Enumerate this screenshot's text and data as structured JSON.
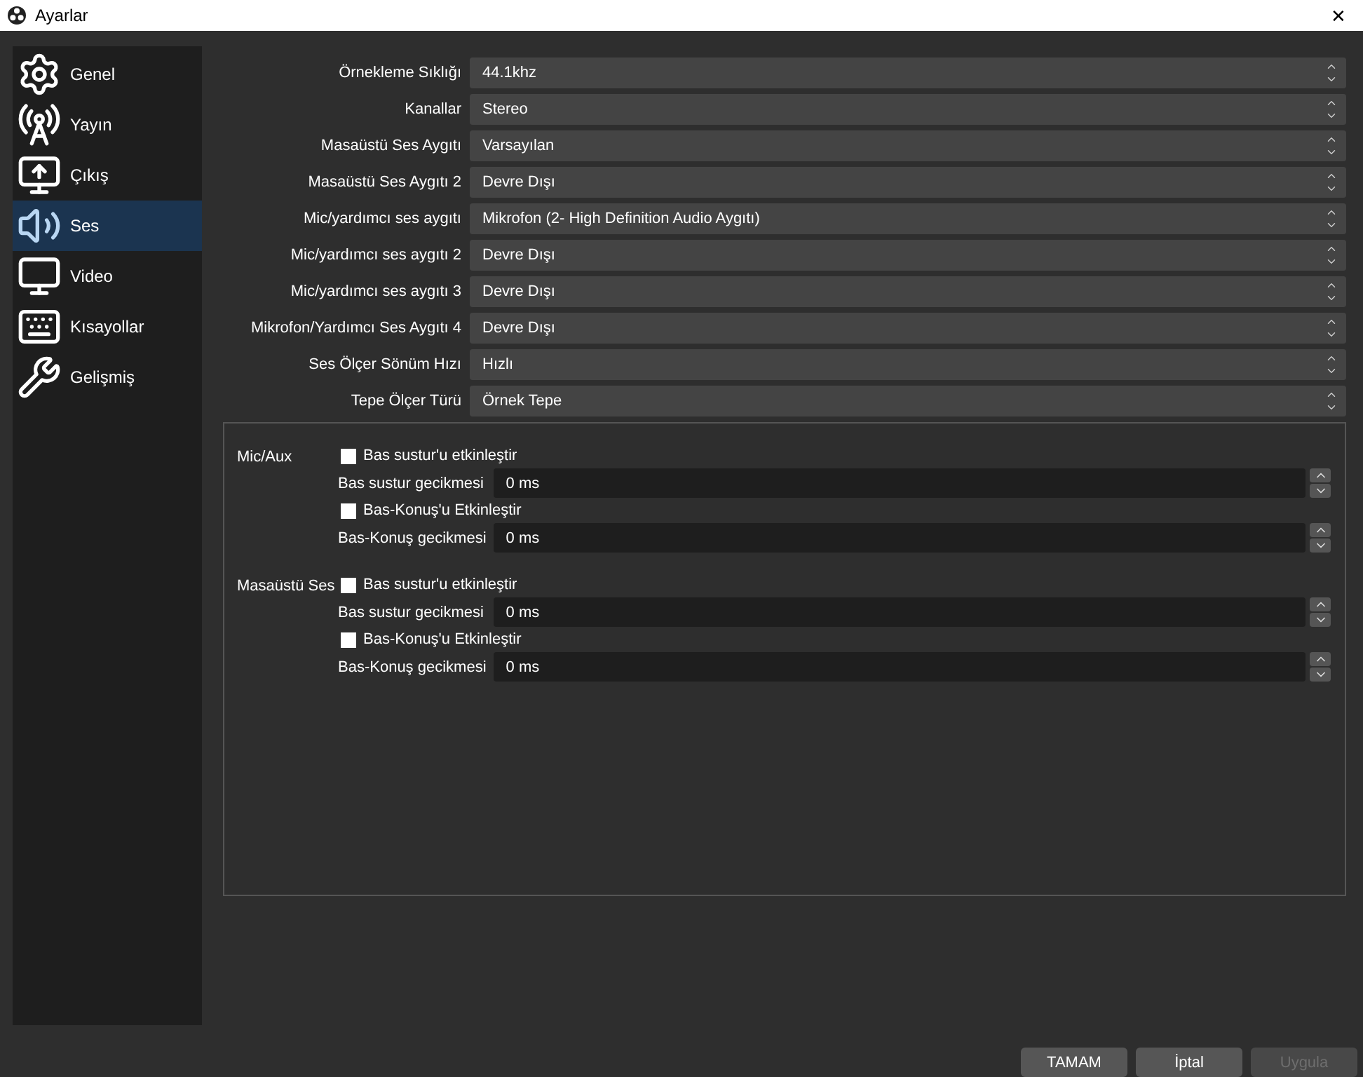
{
  "window": {
    "title": "Ayarlar",
    "close": "✕"
  },
  "sidebar": {
    "items": [
      {
        "label": "Genel",
        "selected": false
      },
      {
        "label": "Yayın",
        "selected": false
      },
      {
        "label": "Çıkış",
        "selected": false
      },
      {
        "label": "Ses",
        "selected": true
      },
      {
        "label": "Video",
        "selected": false
      },
      {
        "label": "Kısayollar",
        "selected": false
      },
      {
        "label": "Gelişmiş",
        "selected": false
      }
    ]
  },
  "form": [
    {
      "label": "Örnekleme Sıklığı",
      "value": "44.1khz"
    },
    {
      "label": "Kanallar",
      "value": "Stereo"
    },
    {
      "label": "Masaüstü Ses Aygıtı",
      "value": "Varsayılan"
    },
    {
      "label": "Masaüstü Ses Aygıtı 2",
      "value": "Devre Dışı"
    },
    {
      "label": "Mic/yardımcı ses aygıtı",
      "value": "Mikrofon (2- High Definition Audio Aygıtı)"
    },
    {
      "label": "Mic/yardımcı ses aygıtı 2",
      "value": "Devre Dışı"
    },
    {
      "label": "Mic/yardımcı ses aygıtı 3",
      "value": "Devre Dışı"
    },
    {
      "label": "Mikrofon/Yardımcı Ses Aygıtı 4",
      "value": "Devre Dışı"
    },
    {
      "label": "Ses Ölçer Sönüm Hızı",
      "value": "Hızlı"
    },
    {
      "label": "Tepe Ölçer Türü",
      "value": "Örnek Tepe"
    }
  ],
  "hotkey_groups": [
    {
      "title": "Mic/Aux",
      "rows": [
        {
          "kind": "checkbox",
          "label": "Bas sustur'u etkinleştir",
          "checked": false
        },
        {
          "kind": "spin",
          "label": "Bas sustur gecikmesi",
          "value": "0 ms"
        },
        {
          "kind": "checkbox",
          "label": "Bas-Konuş'u Etkinleştir",
          "checked": false
        },
        {
          "kind": "spin",
          "label": "Bas-Konuş gecikmesi",
          "value": "0 ms"
        }
      ]
    },
    {
      "title": "Masaüstü Ses",
      "rows": [
        {
          "kind": "checkbox",
          "label": "Bas sustur'u etkinleştir",
          "checked": false
        },
        {
          "kind": "spin",
          "label": "Bas sustur gecikmesi",
          "value": "0 ms"
        },
        {
          "kind": "checkbox",
          "label": "Bas-Konuş'u Etkinleştir",
          "checked": false
        },
        {
          "kind": "spin",
          "label": "Bas-Konuş gecikmesi",
          "value": "0 ms"
        }
      ]
    }
  ],
  "buttons": [
    {
      "label": "TAMAM",
      "disabled": false
    },
    {
      "label": "İptal",
      "disabled": false
    },
    {
      "label": "Uygula",
      "disabled": true
    }
  ]
}
